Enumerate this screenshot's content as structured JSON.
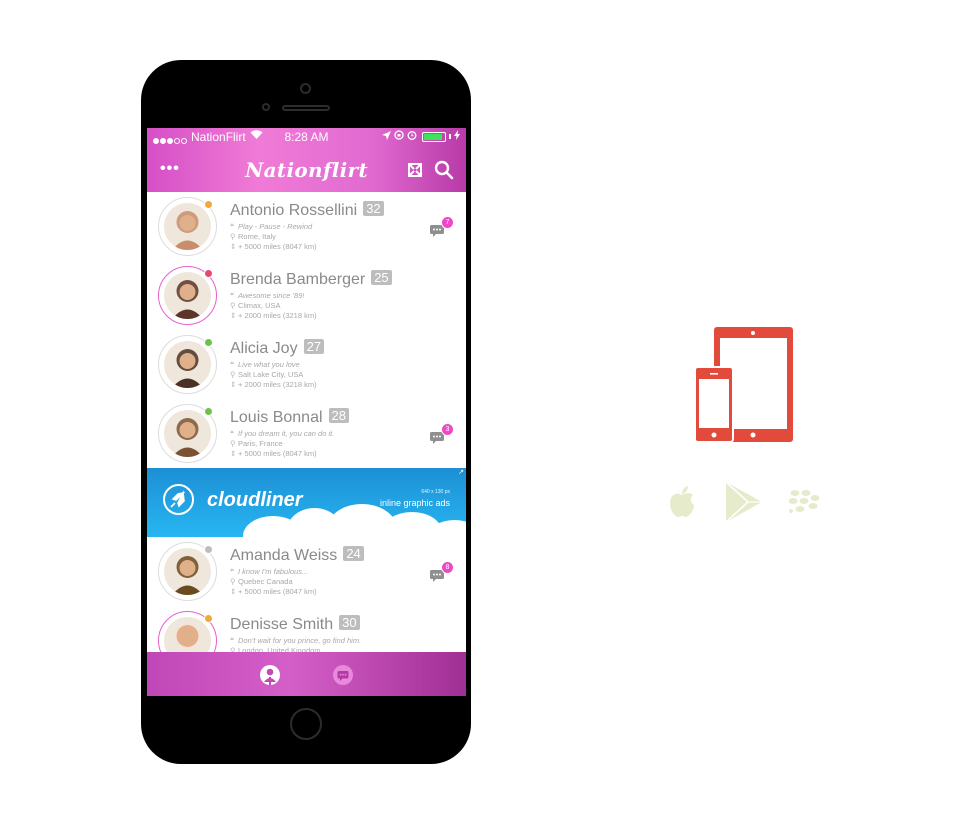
{
  "status_bar": {
    "carrier": "NationFlirt",
    "time": "8:28 AM"
  },
  "header": {
    "app_title": "Nationflirt"
  },
  "users": [
    {
      "name": "Antonio Rossellini",
      "age": "32",
      "quote": "Play - Pause - Rewind",
      "location": "Rome, Italy",
      "distance": "+ 5000 miles (8047 km)",
      "status": "away",
      "status_color": "#f2a93b",
      "highlighted": false,
      "messages": "7",
      "avatar_bg": "#c98d6c"
    },
    {
      "name": "Brenda Bamberger",
      "age": "25",
      "quote": "Awesome since '89!",
      "location": "Climax, USA",
      "distance": "+ 2000 miles (3218 km)",
      "status": "busy",
      "status_color": "#e5486a",
      "highlighted": true,
      "messages": "",
      "avatar_bg": "#5a3528"
    },
    {
      "name": "Alicia Joy",
      "age": "27",
      "quote": "Live what you love",
      "location": "Salt Lake City, USA",
      "distance": "+ 2000 miles (3218 km)",
      "status": "online",
      "status_color": "#6cc24a",
      "highlighted": false,
      "messages": "",
      "avatar_bg": "#4a3025"
    },
    {
      "name": "Louis Bonnal",
      "age": "28",
      "quote": "If you dream it, you can do it.",
      "location": "Paris, France",
      "distance": "+ 5000 miles (8047 km)",
      "status": "online",
      "status_color": "#6cc24a",
      "highlighted": false,
      "messages": "3",
      "avatar_bg": "#7b5234"
    },
    {
      "name": "Amanda Weiss",
      "age": "24",
      "quote": "I know I'm fabulous...",
      "location": "Quebec Canada",
      "distance": "+ 5000 miles (8047 km)",
      "status": "offline",
      "status_color": "#bdbdbd",
      "highlighted": false,
      "messages": "8",
      "avatar_bg": "#6b4a1f"
    },
    {
      "name": "Denisse Smith",
      "age": "30",
      "quote": "Don't wait for you prince, go find him.",
      "location": "London, United Kingdom",
      "distance": "",
      "status": "away",
      "status_color": "#f2a93b",
      "highlighted": true,
      "messages": "",
      "avatar_bg": "#e7a27c"
    }
  ],
  "ad": {
    "brand": "cloudliner",
    "size_label": "640 x 130 px",
    "tagline": "inline graphic ads"
  },
  "tab_bar": {
    "icons": [
      "profile-tab-icon",
      "chat-tab-icon"
    ]
  },
  "platforms": {
    "devices_icon": "phone-tablet-icon",
    "store_icons": [
      "apple-icon",
      "google-play-icon",
      "blackberry-icon"
    ],
    "accent_color": "#e24b3b",
    "store_color": "#e6ebcc"
  },
  "colors": {
    "brand_pink": "#e16ad1",
    "badge_gray": "#bdbdbd",
    "count_pink": "#ee48c9"
  }
}
